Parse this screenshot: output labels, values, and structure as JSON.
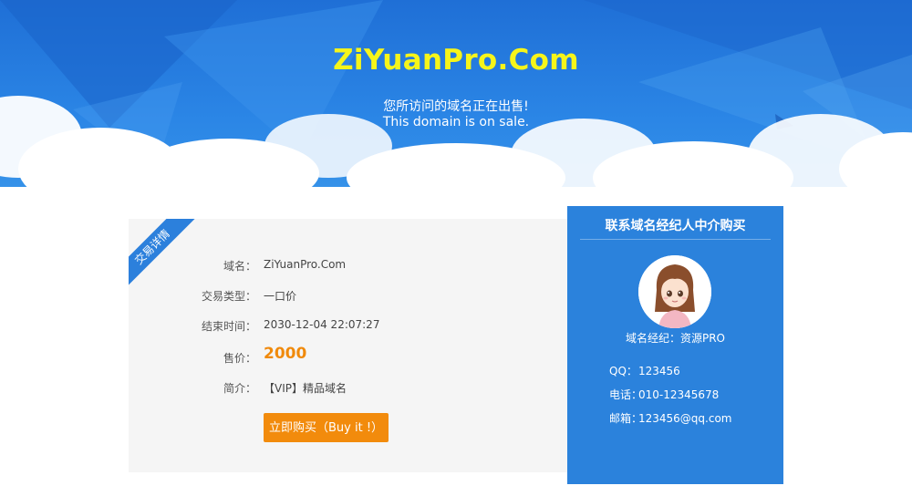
{
  "hero": {
    "title": "ZiYuanPro.Com",
    "sale_cn": "您所访问的域名正在出售!",
    "sale_en": "This domain is on sale."
  },
  "detail": {
    "ribbon": "交易详情",
    "rows": [
      {
        "label": "域名：",
        "value": "ZiYuanPro.Com"
      },
      {
        "label": "交易类型：",
        "value": "一口价"
      },
      {
        "label": "结束时间：",
        "value": "2030-12-04 22:07:27"
      },
      {
        "label": "售价：",
        "value": "2000"
      },
      {
        "label": "简介：",
        "value": "【VIP】精品域名"
      }
    ],
    "buy_label": "立即购买（Buy it !）"
  },
  "broker": {
    "title": "联系域名经纪人中介购买",
    "name": "域名经纪：资源PRO",
    "contacts": [
      {
        "key": "QQ：",
        "value": "123456"
      },
      {
        "key": "电话：",
        "value": "010-12345678"
      },
      {
        "key": "邮箱：",
        "value": "123456@qq.com"
      }
    ]
  },
  "colors": {
    "hero_blue": "#2b86e6",
    "title_yellow": "#f6f51a",
    "price_orange": "#f08a0c",
    "button_orange": "#f28b0c",
    "broker_blue": "#2b82dc",
    "detail_bg": "#f5f5f5"
  }
}
